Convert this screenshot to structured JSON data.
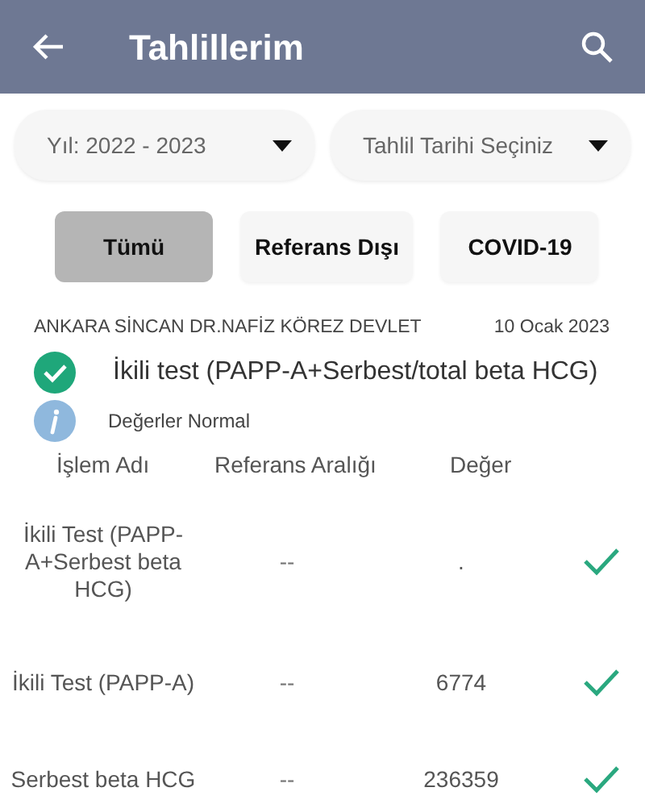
{
  "header": {
    "title": "Tahlillerim"
  },
  "dropdowns": [
    {
      "value": "Yıl: 2022 - 2023"
    },
    {
      "value": "Tahlil Tarihi Seçiniz"
    }
  ],
  "filters": [
    {
      "label": "Tümü",
      "selected": true
    },
    {
      "label": "Referans Dışı",
      "selected": false
    },
    {
      "label": "COVID-19",
      "selected": false
    }
  ],
  "result": {
    "hospital": "ANKARA SİNCAN DR.NAFİZ KÖREZ DEVLET",
    "date": "10 Ocak 2023",
    "title": "İkili test (PAPP-A+Serbest/total beta HCG)",
    "normal": true,
    "note": "Değerler Normal"
  },
  "table": {
    "columns": [
      "İşlem Adı",
      "Referans Aralığı",
      "Değer"
    ],
    "rows": [
      {
        "name": "İkili Test (PAPP-A+Serbest beta HCG)",
        "range": "--",
        "value": ".",
        "normal": true
      },
      {
        "name": "İkili Test (PAPP-A)",
        "range": "--",
        "value": "6774",
        "normal": true
      },
      {
        "name": "Serbest beta HCG",
        "range": "--",
        "value": "236359",
        "normal": true
      }
    ]
  }
}
